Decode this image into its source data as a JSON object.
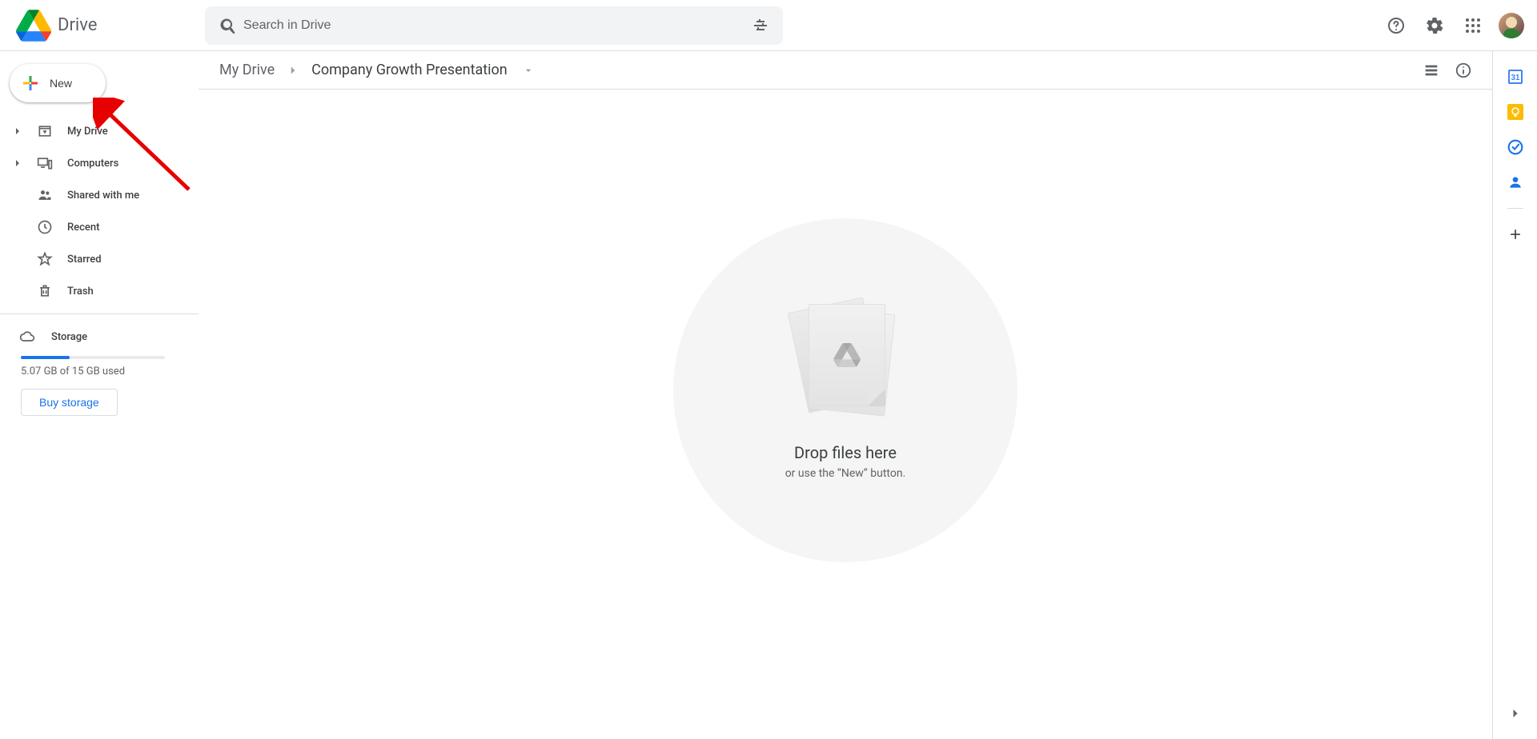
{
  "app_title": "Drive",
  "search": {
    "placeholder": "Search in Drive"
  },
  "sidebar": {
    "new_label": "New",
    "items": [
      {
        "label": "My Drive"
      },
      {
        "label": "Computers"
      },
      {
        "label": "Shared with me"
      },
      {
        "label": "Recent"
      },
      {
        "label": "Starred"
      },
      {
        "label": "Trash"
      }
    ],
    "storage": {
      "label": "Storage",
      "used_text": "5.07 GB of 15 GB used",
      "buy_label": "Buy storage",
      "percent": 33.8
    }
  },
  "breadcrumb": {
    "root": "My Drive",
    "current": "Company Growth Presentation"
  },
  "empty_state": {
    "title": "Drop files here",
    "subtitle": "or use the “New” button."
  },
  "colors": {
    "accent": "#1a73e8",
    "red": "#ea4335",
    "yellow": "#fbbc04",
    "green": "#34a853",
    "blue": "#4285f4",
    "gray_bg": "#f1f3f4"
  }
}
